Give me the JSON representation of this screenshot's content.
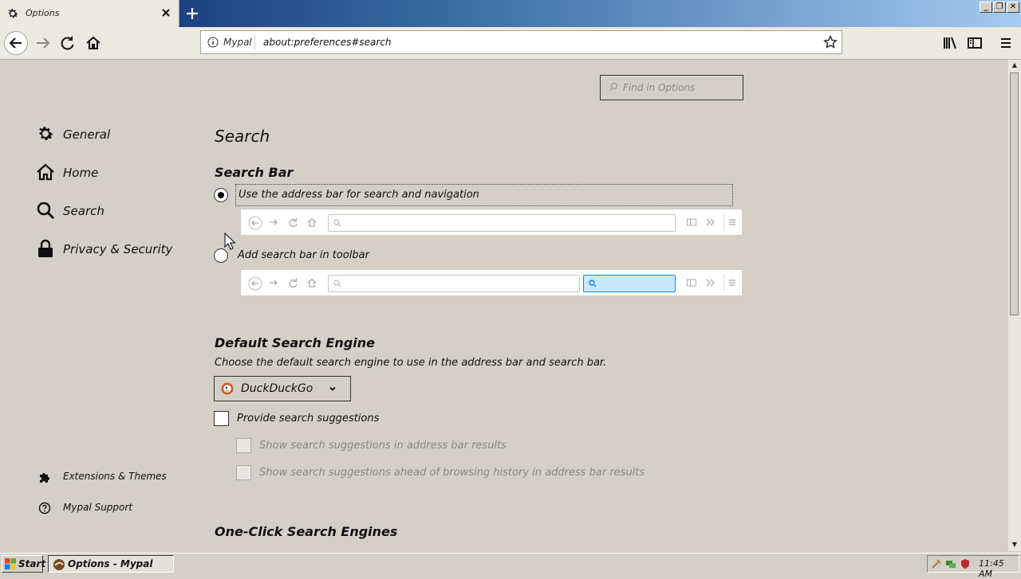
{
  "tab": {
    "title": "Options",
    "icon": "gear-icon"
  },
  "window_controls": [
    "_",
    "❐",
    "✕"
  ],
  "nav": {
    "identity_label": "Mypal",
    "url": "about:preferences#search"
  },
  "find": {
    "placeholder": "Find in Options"
  },
  "sidebar": {
    "items": [
      {
        "label": "General",
        "icon": "gear-icon"
      },
      {
        "label": "Home",
        "icon": "home-icon"
      },
      {
        "label": "Search",
        "icon": "search-icon"
      },
      {
        "label": "Privacy & Security",
        "icon": "lock-icon"
      }
    ],
    "footer": [
      {
        "label": "Extensions & Themes",
        "icon": "puzzle-icon"
      },
      {
        "label": "Mypal Support",
        "icon": "help-icon"
      }
    ]
  },
  "page": {
    "title": "Search",
    "search_bar": {
      "heading": "Search Bar",
      "option_address": "Use the address bar for search and navigation",
      "option_toolbar": "Add search bar in toolbar",
      "selected": "address"
    },
    "default_engine": {
      "heading": "Default Search Engine",
      "description": "Choose the default search engine to use in the address bar and search bar.",
      "selected": "DuckDuckGo"
    },
    "suggestions": {
      "provide": "Provide search suggestions",
      "in_address_bar": "Show search suggestions in address bar results",
      "ahead_of_history": "Show search suggestions ahead of browsing history in address bar results"
    },
    "one_click": {
      "heading": "One-Click Search Engines"
    }
  },
  "taskbar": {
    "start_label": "Start",
    "task_label": "Options - Mypal",
    "clock": "11:45 AM"
  }
}
